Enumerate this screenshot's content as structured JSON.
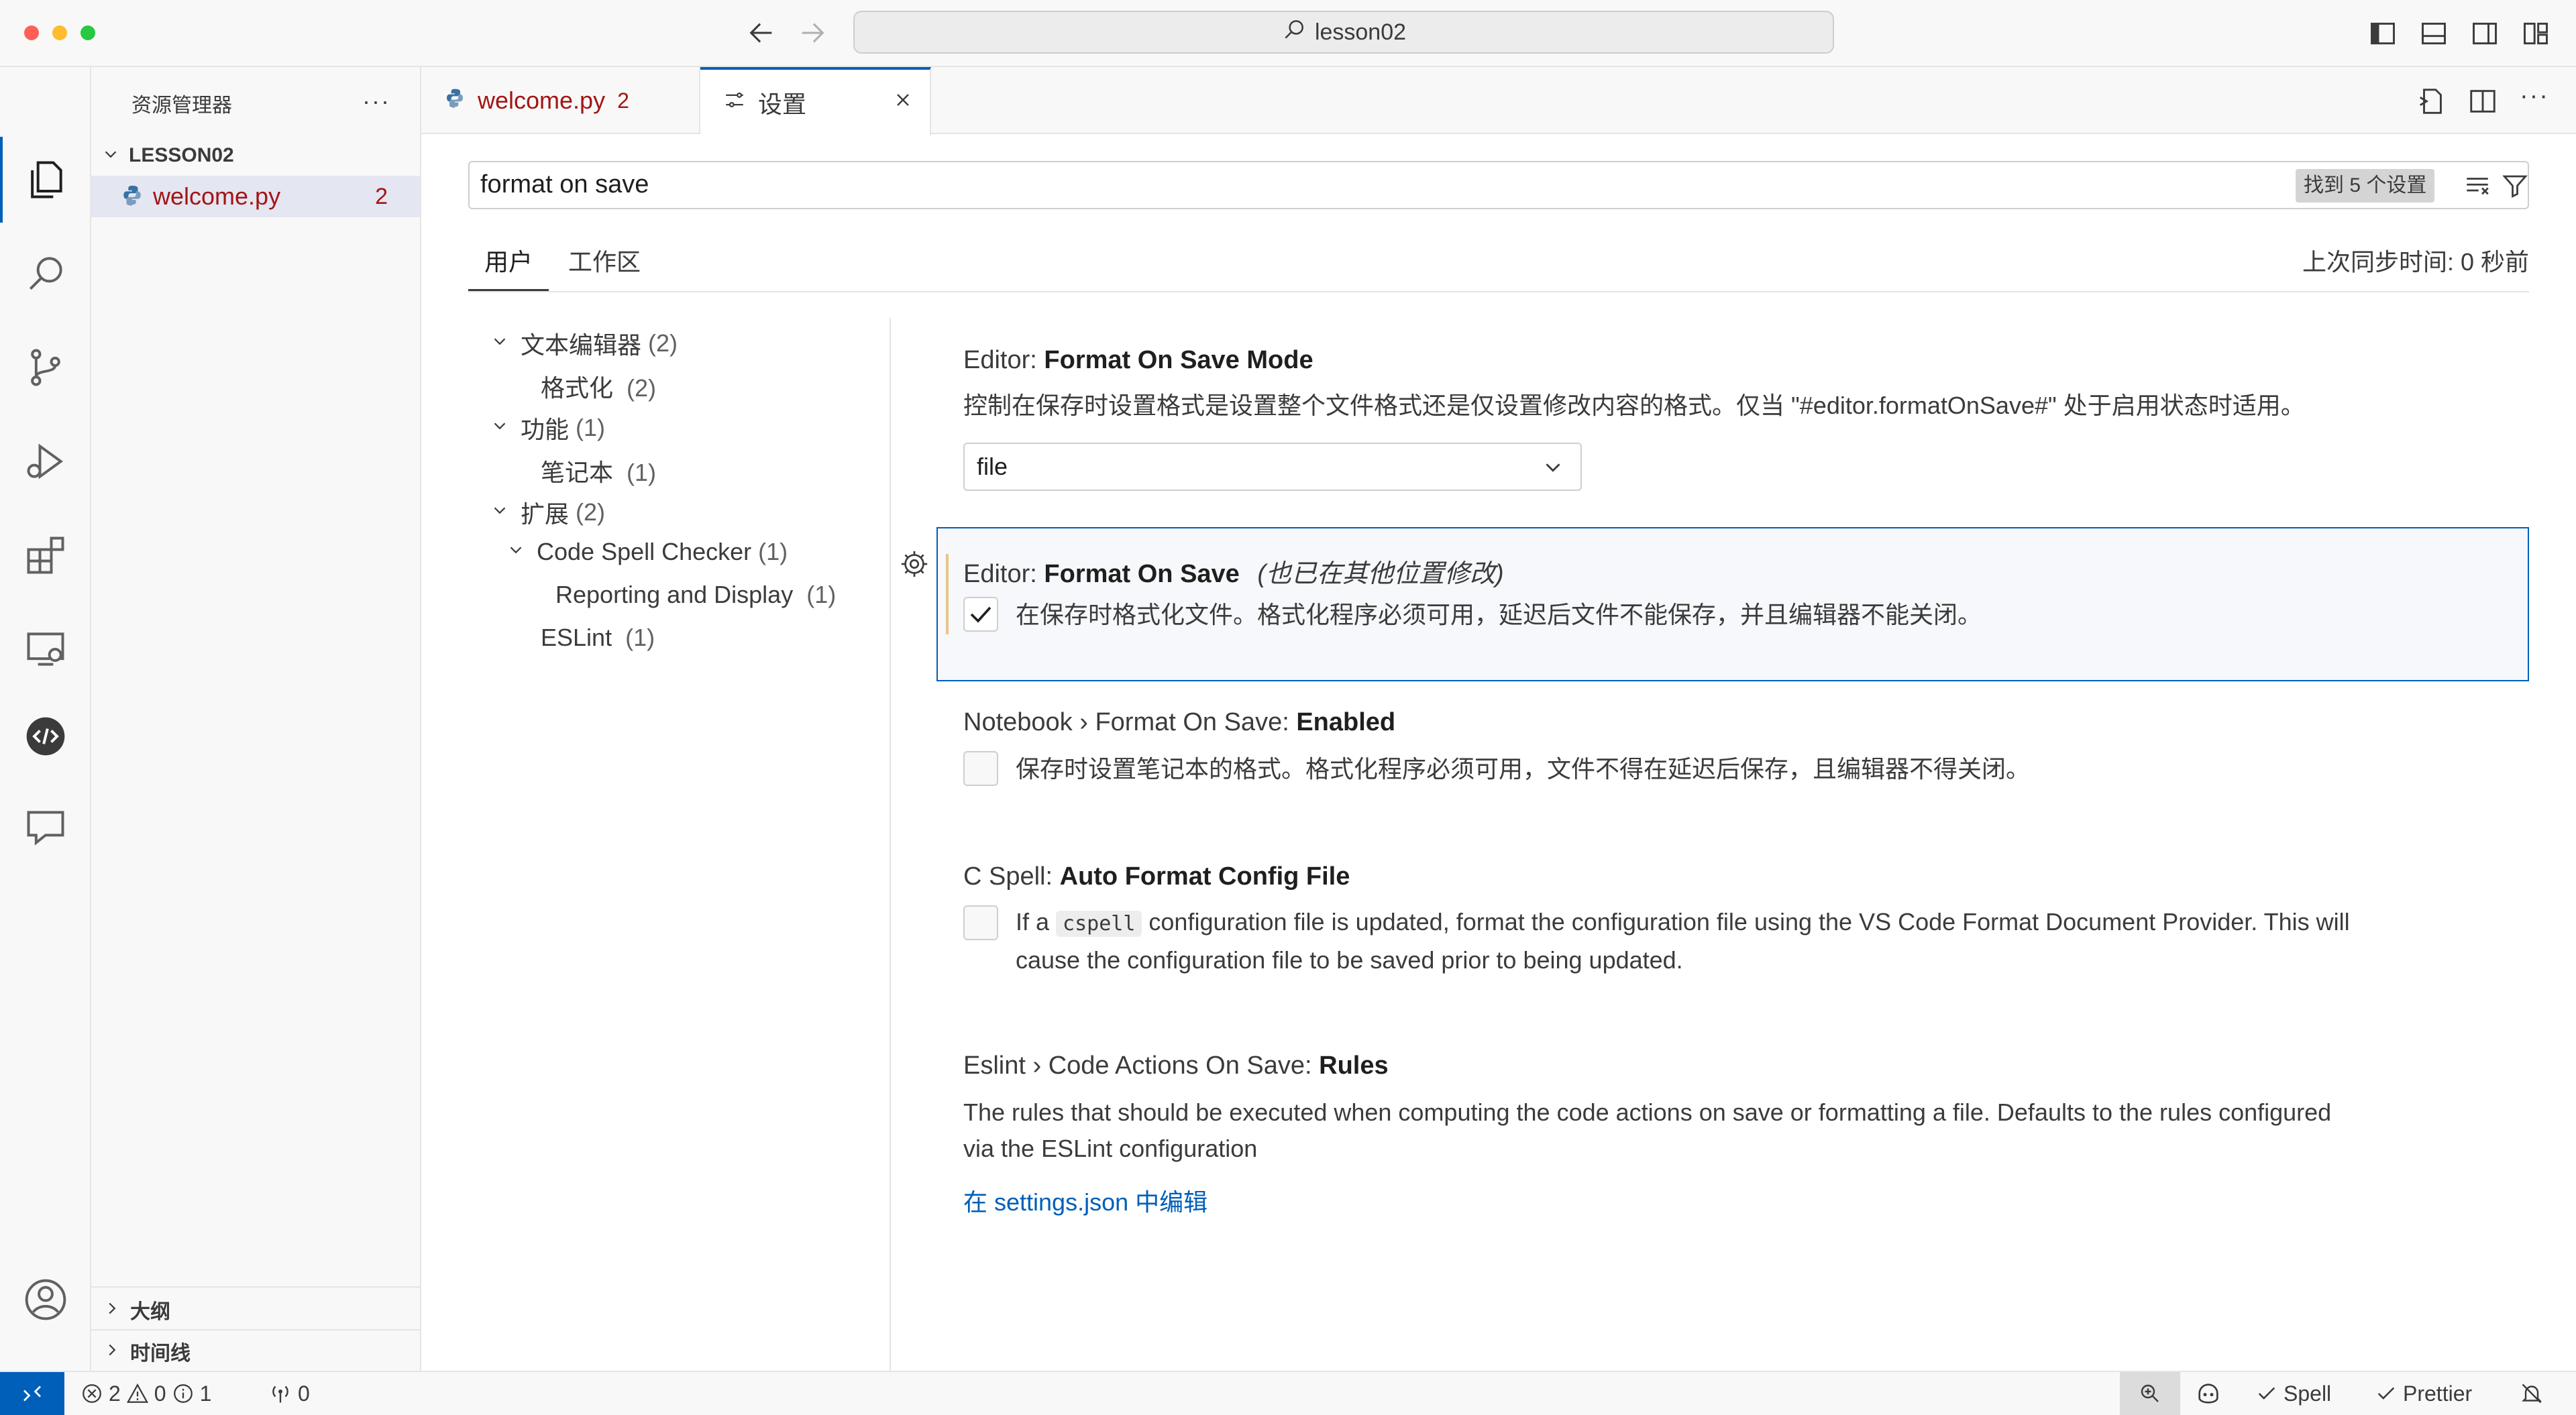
{
  "window": {
    "title": "lesson02"
  },
  "explorer": {
    "title": "资源管理器",
    "folder": "LESSON02",
    "files": [
      {
        "name": "welcome.py",
        "problems": "2"
      }
    ],
    "outline": "大纲",
    "timeline": "时间线"
  },
  "tabs": [
    {
      "label": "welcome.py",
      "badge": "2"
    },
    {
      "label": "设置"
    }
  ],
  "settings": {
    "search_value": "format on save",
    "found_badge": "找到 5 个设置",
    "scope_tabs": [
      "用户",
      "工作区"
    ],
    "sync_status": "上次同步时间: 0 秒前",
    "toc": [
      {
        "label": "文本编辑器",
        "count": "(2)"
      },
      {
        "label": "格式化",
        "count": "(2)"
      },
      {
        "label": "功能",
        "count": "(1)"
      },
      {
        "label": "笔记本",
        "count": "(1)"
      },
      {
        "label": "扩展",
        "count": "(2)"
      },
      {
        "label": "Code Spell Checker",
        "count": "(1)"
      },
      {
        "label": "Reporting and Display",
        "count": "(1)"
      },
      {
        "label": "ESLint",
        "count": "(1)"
      }
    ],
    "items": [
      {
        "category": "Editor: ",
        "name": "Format On Save Mode",
        "description": "控制在保存时设置格式是设置整个文件格式还是仅设置修改内容的格式。仅当 \"#editor.formatOnSave#\" 处于启用状态时适用。",
        "dropdown_value": "file"
      },
      {
        "category": "Editor: ",
        "name": "Format On Save",
        "modified_note": "(也已在其他位置修改)",
        "description": "在保存时格式化文件。格式化程序必须可用，延迟后文件不能保存，并且编辑器不能关闭。",
        "checked": true
      },
      {
        "category": "Notebook › Format On Save: ",
        "name": "Enabled",
        "description": "保存时设置笔记本的格式。格式化程序必须可用，文件不得在延迟后保存，且编辑器不得关闭。",
        "checked": false
      },
      {
        "category": "C Spell: ",
        "name": "Auto Format Config File",
        "description_pre": "If a ",
        "code": "cspell",
        "description_post_line1": " configuration file is updated, format the configuration file using the VS Code Format Document Provider. This will",
        "description_line2": "cause the configuration file to be saved prior to being updated.",
        "checked": false
      },
      {
        "category": "Eslint › Code Actions On Save: ",
        "name": "Rules",
        "description_line1": "The rules that should be executed when computing the code actions on save or formatting a file. Defaults to the rules configured",
        "description_line2": "via the ESLint configuration",
        "link": "在 settings.json 中编辑"
      }
    ]
  },
  "statusbar": {
    "errors": "2",
    "warnings": "0",
    "infos": "1",
    "ports": "0",
    "spell": "Spell",
    "prettier": "Prettier"
  },
  "colors": {
    "accent": "#005fb8",
    "error_text": "#a31515",
    "modified_bar": "#e9c48a",
    "remote_bg": "#005fb8"
  }
}
